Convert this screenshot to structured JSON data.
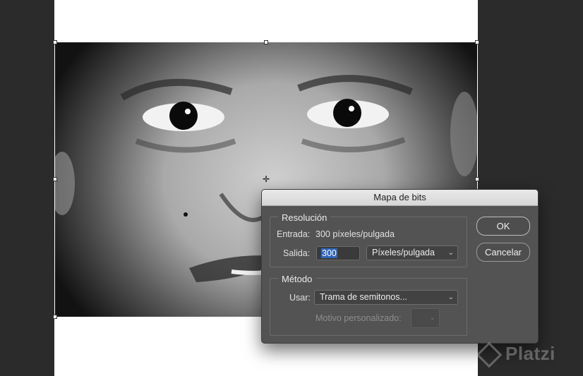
{
  "dialog": {
    "title": "Mapa de bits",
    "resolution": {
      "legend": "Resolución",
      "input_label": "Entrada:",
      "input_value": "300 píxeles/pulgada",
      "output_label": "Salida:",
      "output_value": "300",
      "output_unit": "Píxeles/pulgada"
    },
    "method": {
      "legend": "Método",
      "use_label": "Usar:",
      "use_value": "Trama de semitonos...",
      "pattern_label": "Motivo personalizado:"
    },
    "buttons": {
      "ok": "OK",
      "cancel": "Cancelar"
    }
  },
  "watermark": {
    "text": "Platzi"
  },
  "colors": {
    "dialog_bg": "#535353",
    "selection": "#2f65b8",
    "workspace": "#2b2b2b"
  }
}
